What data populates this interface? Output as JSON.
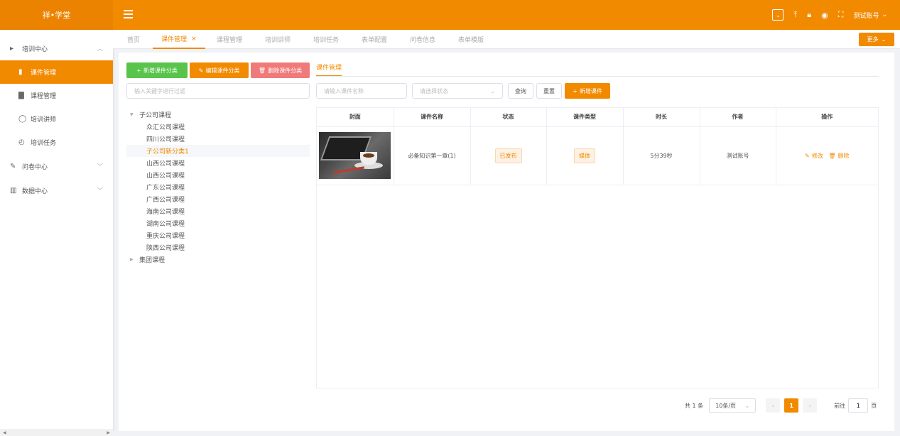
{
  "app": {
    "logo": "祥•学堂"
  },
  "header": {
    "user_name": "测试账号"
  },
  "sidebar": {
    "groups": [
      {
        "label": "培训中心",
        "expanded": true
      },
      {
        "label": "问卷中心",
        "expanded": false
      },
      {
        "label": "数据中心",
        "expanded": false
      }
    ],
    "items": [
      {
        "label": "课件管理",
        "active": true
      },
      {
        "label": "课程管理"
      },
      {
        "label": "培训讲师"
      },
      {
        "label": "培训任务"
      }
    ]
  },
  "tabs": [
    {
      "label": "首页"
    },
    {
      "label": "课件管理",
      "active": true,
      "close": "×"
    },
    {
      "label": "课程管理"
    },
    {
      "label": "培训讲师"
    },
    {
      "label": "培训任务"
    },
    {
      "label": "表单配置"
    },
    {
      "label": "问卷信息"
    },
    {
      "label": "表单模版"
    }
  ],
  "more_label": "更多",
  "left_panel": {
    "add_category": "新增课件分类",
    "edit_category": "编辑课件分类",
    "delete_category": "删除课件分类",
    "filter_placeholder": "输入关键字进行过滤",
    "tree": {
      "root": "子公司课程",
      "children": [
        "众汇公司课程",
        "四川公司课程",
        "子公司新分类1",
        "山西公司课程",
        "山西公司课程",
        "广东公司课程",
        "广西公司课程",
        "海南公司课程",
        "湖南公司课程",
        "重庆公司课程",
        "陕西公司课程"
      ],
      "selected_index": 2,
      "root2": "集团课程"
    }
  },
  "right_panel": {
    "tab": "课件管理",
    "name_placeholder": "请输入课件名称",
    "status_placeholder": "请选择状态",
    "query": "查询",
    "reset": "重置",
    "add": "新增课件",
    "columns": [
      "封面",
      "课件名称",
      "状态",
      "课件类型",
      "时长",
      "作者",
      "操作"
    ],
    "rows": [
      {
        "name": "必备知识第一章(1)",
        "status": "已发布",
        "type": "媒体",
        "duration": "5分39秒",
        "author": "测试账号",
        "edit": "修改",
        "delete": "删除"
      }
    ]
  },
  "pager": {
    "total": "共 1 条",
    "page_size": "10条/页",
    "current": "1",
    "goto_label": "前往",
    "goto_value": "1",
    "page_unit": "页"
  }
}
